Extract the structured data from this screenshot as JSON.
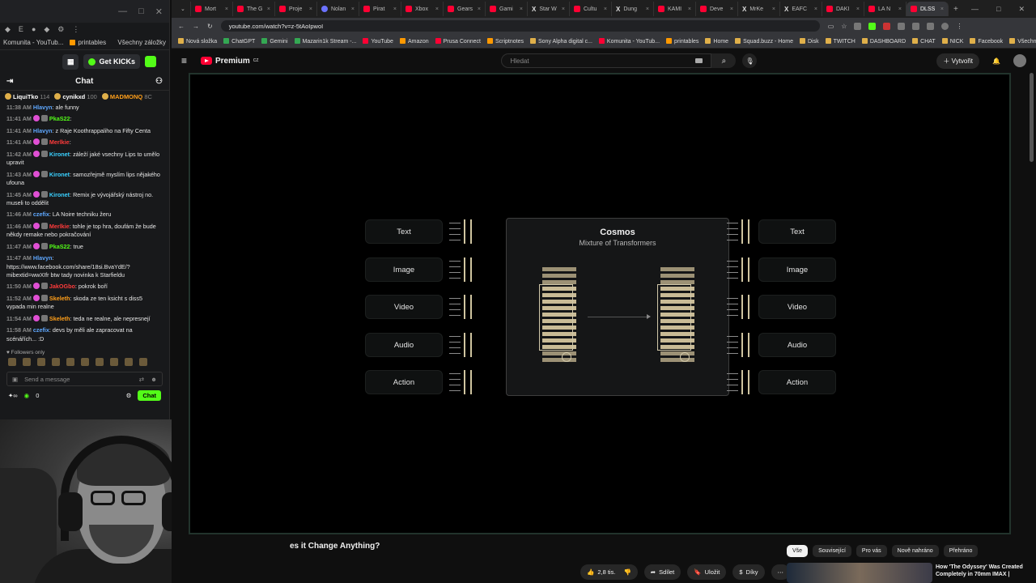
{
  "left_window": {
    "bookmarks": [
      "Komunita - YouTub...",
      "printables",
      "Všechny záložky"
    ],
    "get_kicks": "Get KICKs",
    "chat_title": "Chat",
    "gifters": [
      {
        "name": "LiquiTko",
        "count": "114"
      },
      {
        "name": "cynikxd",
        "count": "100"
      },
      {
        "name": "MADMONQ",
        "count": "8C"
      }
    ],
    "messages": [
      {
        "time": "11:38 AM",
        "user": "Hlavyn",
        "color": "#5fa8ff",
        "text": "ale funny"
      },
      {
        "time": "11:41 AM",
        "user": "PkaS22",
        "color": "#53fc18",
        "text": ""
      },
      {
        "time": "11:41 AM",
        "user": "Hlavyn",
        "color": "#5fa8ff",
        "text": "z Raje Koothrappaliho na Fifty Centa"
      },
      {
        "time": "11:41 AM",
        "user": "Merlkie",
        "color": "#ff3b3b",
        "text": ""
      },
      {
        "time": "11:42 AM",
        "user": "Kironet",
        "color": "#3ad0ff",
        "text": "záleží jaké vsechny Lips to umělo upravit"
      },
      {
        "time": "11:43 AM",
        "user": "Kironet",
        "color": "#3ad0ff",
        "text": "samozřejmě myslím lips nějakého ufouna"
      },
      {
        "time": "11:45 AM",
        "user": "Kironet",
        "color": "#3ad0ff",
        "text": "Remix je vývojářský nástroj no. museli to oddělit"
      },
      {
        "time": "11:46 AM",
        "user": "czefix",
        "color": "#5fa8ff",
        "text": "LA Noire techniku žeru"
      },
      {
        "time": "11:46 AM",
        "user": "Merlkie",
        "color": "#ff3b3b",
        "text": "tohle je top hra, doufám že bude někdy remake nebo pokračování"
      },
      {
        "time": "11:47 AM",
        "user": "PkaS22",
        "color": "#53fc18",
        "text": "true"
      },
      {
        "time": "11:47 AM",
        "user": "Hlavyn",
        "color": "#5fa8ff",
        "text": "https://www.facebook.com/share/18si.BvaYdE/?mibextid=wwXIfr btw tady novinka k Starfieldu"
      },
      {
        "time": "11:50 AM",
        "user": "JakOGbo",
        "color": "#ff3b3b",
        "text": "pokrok boří"
      },
      {
        "time": "11:52 AM",
        "user": "Skeleth",
        "color": "#ff9f1a",
        "text": "skoda ze ten ksicht s diss5 vypada min realne"
      },
      {
        "time": "11:54 AM",
        "user": "Skeleth",
        "color": "#ff9f1a",
        "text": "teda ne realne, ale nepresnejí"
      },
      {
        "time": "11:58 AM",
        "user": "czefix",
        "color": "#5fa8ff",
        "text": "devs by měli ale zapracovat na scénářích... :D"
      }
    ],
    "followers_only": "Followers only",
    "send_placeholder": "Send a message",
    "viewers": "0",
    "chat_button": "Chat"
  },
  "browser": {
    "tabs": [
      "Mort",
      "The G",
      "Proje",
      "Nolan",
      "Pirat",
      "Xbox",
      "Gears",
      "Gami",
      "Star W",
      "Cultu",
      "Dung",
      "KAMI",
      "Deve",
      "MrKe",
      "EAFC",
      "DAKI",
      "LA N",
      "DLSS"
    ],
    "url": "youtube.com/watch?v=z-5tAoIpwoI",
    "bookmarks": [
      "Nová složka",
      "ChatGPT",
      "Gemini",
      "Mazarin1k Stream -...",
      "YouTube",
      "Amazon",
      "Prusa Connect",
      "Scriptnotes",
      "Sony Alpha digital c...",
      "Komunita - YouTub...",
      "printables",
      "Home",
      "Squad.buzz - Home",
      "Disk",
      "TWITCH",
      "DASHBOARD",
      "CHAT",
      "NICK",
      "Facebook",
      "Všechny záložky"
    ]
  },
  "youtube": {
    "brand": "Premium",
    "region": "CZ",
    "search_placeholder": "Hledat",
    "create_label": "Vytvořit",
    "video": {
      "left_labels": [
        "Text",
        "Image",
        "Video",
        "Audio",
        "Action"
      ],
      "right_labels": [
        "Text",
        "Image",
        "Video",
        "Audio",
        "Action"
      ],
      "model_title": "Cosmos",
      "model_subtitle": "Mixture of Transformers"
    },
    "video_title": "es it Change Anything?",
    "chips": [
      "Vše",
      "Související",
      "Pro vás",
      "Nově nahráno",
      "Přehráno"
    ],
    "actions": {
      "likes": "2,8 tis.",
      "share": "Sdílet",
      "save": "Uložit",
      "thanks": "Díky"
    },
    "recommended_title": "How 'The Odyssey' Was Created Completely in 70mm IMAX |"
  }
}
